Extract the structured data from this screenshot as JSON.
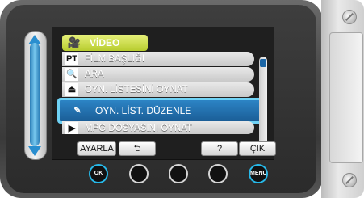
{
  "colors": {
    "category_bg": "#c5d640",
    "selected_bg": "#1e66a8",
    "selected_border": "#6fd2f5",
    "menu_item_bg": "#d8d8d8",
    "screen_bg": "#1f1f1f"
  },
  "category": {
    "icon": "video-camera-icon",
    "glyph": "🎥",
    "label": "VİDEO"
  },
  "menu": {
    "items": [
      {
        "icon": "pt-icon",
        "glyph": "PT",
        "label": "FİLM BAŞLIĞI"
      },
      {
        "icon": "search-icon",
        "glyph": "🔍",
        "label": "ARA"
      },
      {
        "icon": "playlist-play-icon",
        "glyph": "⏏",
        "label": "OYN. LİSTESİNİ OYNAT"
      },
      {
        "icon": "playlist-edit-icon",
        "glyph": "✎",
        "label": "OYN. LİST. DÜZENLE"
      },
      {
        "icon": "mpg-play-icon",
        "glyph": "▶",
        "label": "MPG DOSYASINI OYNAT"
      }
    ],
    "selected_index": 3
  },
  "softkeys": {
    "set": "AYARLA",
    "back_glyph": "⮌",
    "help": "?",
    "exit": "ÇIK"
  },
  "hardware": {
    "ok_text": "OK",
    "menu_text": "MENU"
  }
}
